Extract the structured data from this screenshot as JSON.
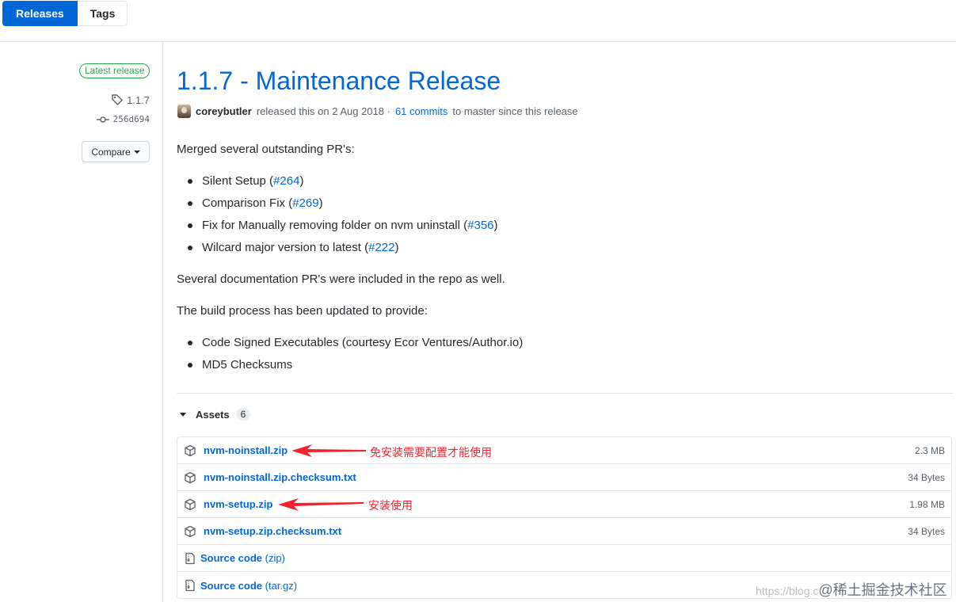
{
  "tabs": {
    "releases": "Releases",
    "tags": "Tags"
  },
  "sidebar": {
    "latest_badge": "Latest release",
    "tag": "1.1.7",
    "commit": "256d694",
    "compare": "Compare"
  },
  "release": {
    "title": "1.1.7 - Maintenance Release",
    "author": "coreybutler",
    "released_text": "released this on 2 Aug 2018 ·",
    "commits_link": "61 commits",
    "since_text": "to master since this release"
  },
  "body": {
    "intro": "Merged several outstanding PR's:",
    "prs": [
      {
        "text": "Silent Setup (",
        "link": "#264",
        "close": ")"
      },
      {
        "text": "Comparison Fix (",
        "link": "#269",
        "close": ")"
      },
      {
        "text": "Fix for Manually removing folder on nvm uninstall (",
        "link": "#356",
        "close": ")"
      },
      {
        "text": "Wilcard major version to latest (",
        "link": "#222",
        "close": ")"
      }
    ],
    "docs_note": "Several documentation PR's were included in the repo as well.",
    "build_intro": "The build process has been updated to provide:",
    "build_items": [
      "Code Signed Executables (courtesy Ecor Ventures/Author.io)",
      "MD5 Checksums"
    ]
  },
  "assets": {
    "label": "Assets",
    "count": "6",
    "files": [
      {
        "name": "nvm-noinstall.zip",
        "size": "2.3 MB"
      },
      {
        "name": "nvm-noinstall.zip.checksum.txt",
        "size": "34 Bytes"
      },
      {
        "name": "nvm-setup.zip",
        "size": "1.98 MB"
      },
      {
        "name": "nvm-setup.zip.checksum.txt",
        "size": "34 Bytes"
      }
    ],
    "sources": [
      {
        "name": "Source code",
        "ext": "(zip)"
      },
      {
        "name": "Source code",
        "ext": "(tar.gz)"
      }
    ]
  },
  "annotations": {
    "noinstall_note": "免安装需要配置才能使用",
    "setup_note": "安装使用",
    "color": "#f5222d"
  },
  "watermark": {
    "url": "https://blog.c",
    "site": "@稀土掘金技术社区"
  }
}
